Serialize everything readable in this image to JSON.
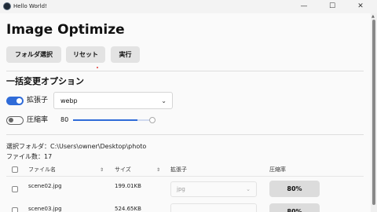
{
  "window": {
    "title": "Hello World!",
    "minimize": "—",
    "maximize": "☐",
    "close": "✕"
  },
  "page_title": "Image Optimize",
  "toolbar": {
    "select_folder": "フォルダ選択",
    "reset": "リセット",
    "run": "実行"
  },
  "options": {
    "title": "一括変更オプション",
    "extension": {
      "label": "拡張子",
      "enabled": true,
      "value": "webp"
    },
    "compression": {
      "label": "圧縮率",
      "enabled": false,
      "value": "80",
      "fraction": 0.8
    }
  },
  "info": {
    "folder": "選択フォルダ：C:\\Users\\owner\\Desktop\\photo",
    "count": "ファイル数：17"
  },
  "table": {
    "headers": {
      "name": "ファイル名",
      "size": "サイズ",
      "ext": "拡張子",
      "rate": "圧縮率"
    },
    "rows": [
      {
        "name": "scene02.jpg",
        "size": "199.01KB",
        "ext": "jpg",
        "rate": "80%"
      },
      {
        "name": "scene03.jpg",
        "size": "524.65KB",
        "ext": "",
        "rate": "80%"
      }
    ]
  },
  "colors": {
    "accent": "#2f6bd8"
  }
}
